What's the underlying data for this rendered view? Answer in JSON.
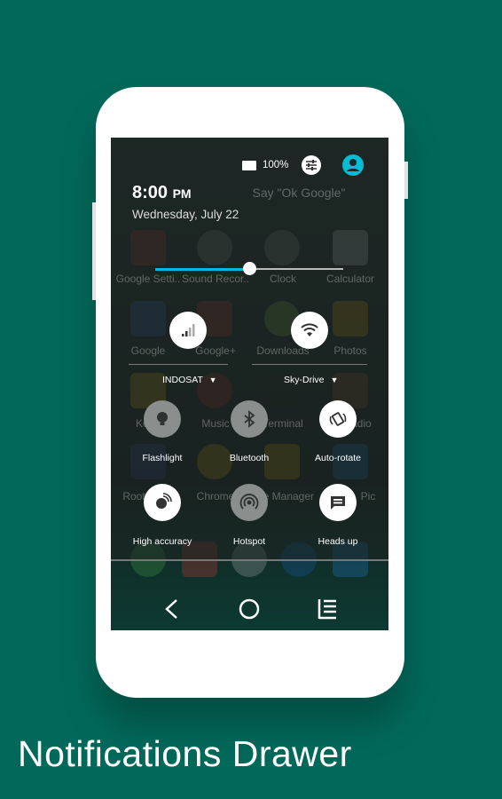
{
  "caption": "Notifications Drawer",
  "status": {
    "battery": "100%"
  },
  "header": {
    "time": "8:00",
    "ampm": "PM",
    "date": "Wednesday, July 22"
  },
  "background_apps": {
    "search_hint": "Say \"Ok Google\"",
    "labels": [
      "Google Setti..",
      "Sound Recor..",
      "Clock",
      "Calculator",
      "Google",
      "Google+",
      "Downloads",
      "Photos",
      "Keep",
      "Music",
      "Terminal",
      "Radio",
      "Root",
      "Chrome",
      "File Manager",
      "Pic"
    ]
  },
  "brightness": {
    "level": 0.5,
    "accent": "#00bcd4"
  },
  "network": {
    "mobile": "INDOSAT",
    "wifi": "Sky-Drive"
  },
  "tiles": [
    {
      "label": "Flashlight",
      "icon": "flashlight-icon",
      "on": false
    },
    {
      "label": "Bluetooth",
      "icon": "bluetooth-icon",
      "on": false
    },
    {
      "label": "Auto-rotate",
      "icon": "auto-rotate-icon",
      "on": true
    },
    {
      "label": "High accuracy",
      "icon": "location-icon",
      "on": true
    },
    {
      "label": "Hotspot",
      "icon": "hotspot-icon",
      "on": false
    },
    {
      "label": "Heads up",
      "icon": "heads-up-icon",
      "on": true
    }
  ]
}
